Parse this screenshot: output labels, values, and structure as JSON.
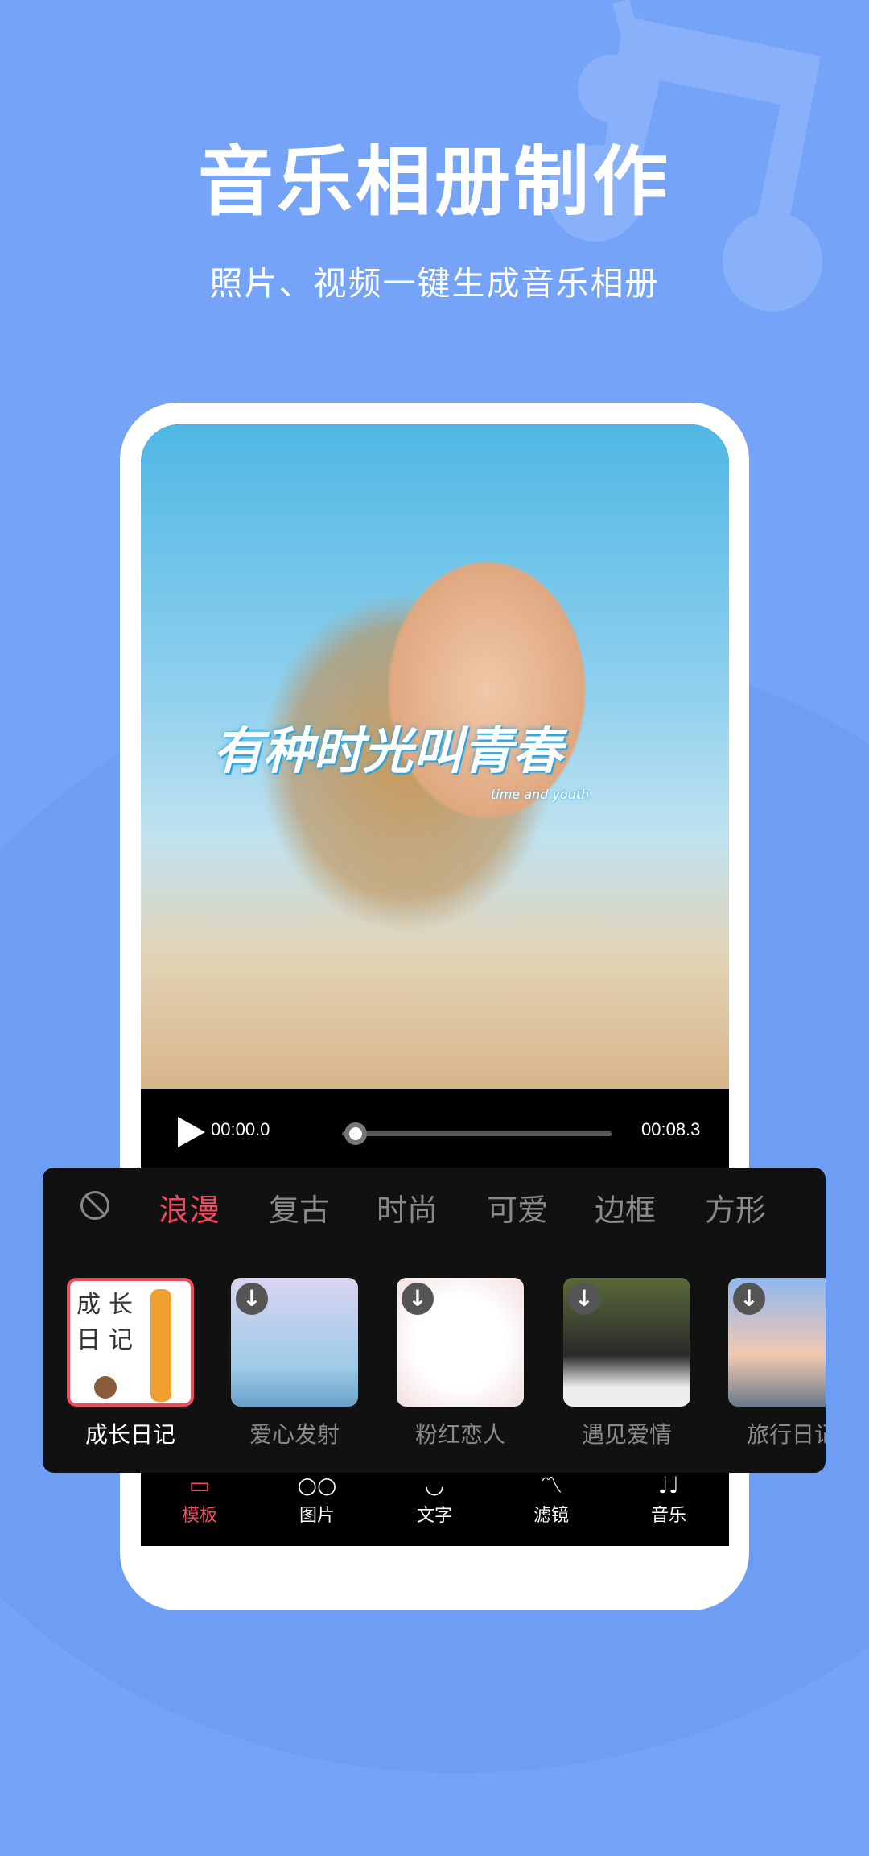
{
  "header": {
    "title": "音乐相册制作",
    "subtitle": "照片、视频一键生成音乐相册"
  },
  "colors": {
    "background": "#74a3f7",
    "accent": "#f04a5e",
    "panel": "#111111"
  },
  "preview": {
    "overlay_title": "有种时光叫青春",
    "overlay_subtitle": "time and youth"
  },
  "player": {
    "current_time": "00:00.0",
    "total_time": "00:08.3",
    "progress": 0
  },
  "categories": {
    "none_icon": "ban-icon",
    "tabs": [
      "浪漫",
      "复古",
      "时尚",
      "可爱",
      "边框",
      "方形"
    ],
    "selected": "浪漫"
  },
  "templates": [
    {
      "label": "成长日记",
      "selected": true,
      "thumb_text": [
        "成",
        "长",
        "日",
        "记"
      ]
    },
    {
      "label": "爱心发射",
      "download": true
    },
    {
      "label": "粉红恋人",
      "download": true
    },
    {
      "label": "遇见爱情",
      "download": true
    },
    {
      "label": "旅行日记",
      "download": true
    }
  ],
  "bottom_nav": [
    {
      "label": "模板",
      "icon": "template-icon",
      "active": true
    },
    {
      "label": "图片",
      "icon": "image-icon"
    },
    {
      "label": "文字",
      "icon": "text-icon"
    },
    {
      "label": "滤镜",
      "icon": "filter-icon"
    },
    {
      "label": "音乐",
      "icon": "music-icon"
    }
  ]
}
